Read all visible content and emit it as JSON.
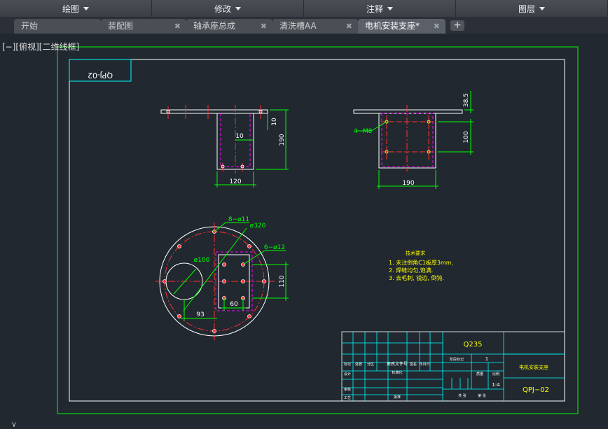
{
  "ribbon": {
    "groups": [
      {
        "label": "绘图"
      },
      {
        "label": "修改"
      },
      {
        "label": "注释"
      },
      {
        "label": "图层"
      }
    ]
  },
  "tabs": [
    {
      "label": "开始",
      "closable": false,
      "active": false
    },
    {
      "label": "装配图",
      "closable": true,
      "active": false
    },
    {
      "label": "轴承座总成",
      "closable": true,
      "active": false
    },
    {
      "label": "清洗槽AA",
      "closable": true,
      "active": false
    },
    {
      "label": "电机安装支座*",
      "closable": true,
      "active": true
    }
  ],
  "tab_close_glyph": "✖",
  "tab_add_glyph": "+",
  "viewport": {
    "label": "[−][俯视][二维线框]"
  },
  "drawing": {
    "corner_code": "QPJ-02",
    "front_dims": {
      "d10a": "10",
      "d10b": "10",
      "d190": "190",
      "d120": "120"
    },
    "side_dims": {
      "d38": "38.5",
      "d100": "100",
      "d190": "190",
      "hole": "4−M8"
    },
    "plan_dims": {
      "holes8": "8−ø11",
      "d320": "ø320",
      "holes6": "6−ø12",
      "d100": "ø100",
      "d110": "110",
      "d60": "60",
      "d93": "93"
    },
    "tech": {
      "title": "技术要求",
      "lines": [
        "1. 未注倒角C1板厚3mm.",
        "2. 焊缝均匀,饱满.",
        "3. 去毛刺, 锐边, 倒钝."
      ]
    },
    "title_block": {
      "material": "Q235",
      "part_name": "电机安装支座",
      "drawing_no": "QPJ−02",
      "scale": "1:4",
      "qty": "1",
      "row_labels": [
        "标记",
        "设计",
        "审核",
        "工艺"
      ],
      "header_cells": [
        "处数",
        "分区",
        "更改文件号",
        "签名",
        "年月日"
      ],
      "misc": [
        "标准化",
        "阶段标记",
        "质量",
        "比例",
        "批准",
        "共 张",
        "第 张"
      ]
    }
  },
  "colors": {
    "canvas_bg": "#212830",
    "frame_green": "#00ff00",
    "border_white": "#ffffff",
    "centerline_red": "#ff3030",
    "cyan": "#00ffff",
    "magenta": "#ff00ff",
    "yellow": "#ffff00"
  }
}
